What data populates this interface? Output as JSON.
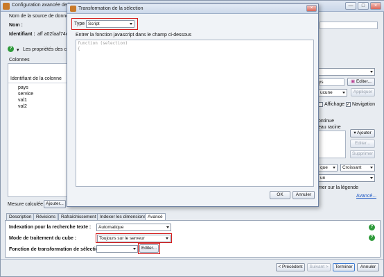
{
  "window": {
    "title": "Configuration avancée de la",
    "ctrl_min": "—",
    "ctrl_max": "□",
    "ctrl_close": "×"
  },
  "form": {
    "source_label": "Nom de la source de donnée",
    "nom_label": "Nom :",
    "identifiant_label": "Identifiant :",
    "identifiant_value": "aff a02faaf74d",
    "props_label": "Les propriétés des co",
    "colonnes_label": "Colonnes",
    "col_header": "Identifiant de la colonne",
    "rows": [
      {
        "name": "pays",
        "val": "0"
      },
      {
        "name": "service",
        "val": "1"
      },
      {
        "name": "val1",
        "val": "2"
      },
      {
        "name": "val2",
        "val": "2"
      }
    ],
    "mesure_label": "Mesure calculée :",
    "ajouter_label": "Ajouter..."
  },
  "right_panel": {
    "combo1": "",
    "field_ys": "ys",
    "editer_btn": "Editer...",
    "aucune_combo": "ucune",
    "appliquer": "Appliquer",
    "affichage": "Affichage",
    "navigation": "Navigation",
    "continue_label": "ontinue",
    "racine_label": "eau racine",
    "ajouter_btn": "▾ Ajouter",
    "editer2_btn": "Editer...",
    "supprimer_btn": "Supprimer",
    "que_combo": "que",
    "croissant_combo": "Croissant",
    "un_combo": "un",
    "legende_label": "mer sur la légende",
    "avance_link": "Avancé..."
  },
  "tabs": [
    "Description",
    "Révisions",
    "Rafraîchissement",
    "Indexer les dimensions",
    "Avancé"
  ],
  "advanced": {
    "indexation_label": "Indexation pour la recherche texte :",
    "indexation_value": "Automatique",
    "mode_label": "Mode de traitement du cube :",
    "mode_value": "Toujours sur le serveur",
    "fonction_label": "Fonction de transformation de sélection :",
    "fonction_value": "",
    "editer_btn": "Editer..."
  },
  "footer": {
    "precedent": "< Précédent",
    "suivant": "Suivant >",
    "terminer": "Terminer",
    "annuler": "Annuler"
  },
  "dialog": {
    "title": "Transformation de la sélection",
    "type_label": "Type",
    "type_value": "Script",
    "instruction": "Entrer la fonction javascript dans le champ ci-dessous",
    "code_line1": "function (selection)",
    "code_line2": "{",
    "ok": "OK",
    "annuler": "Annuler",
    "close": "×"
  },
  "help_icon_glyph": "?",
  "colors": {
    "highlight": "#d41c1c",
    "help": "#2e9a3a",
    "link": "#1a56c4"
  }
}
